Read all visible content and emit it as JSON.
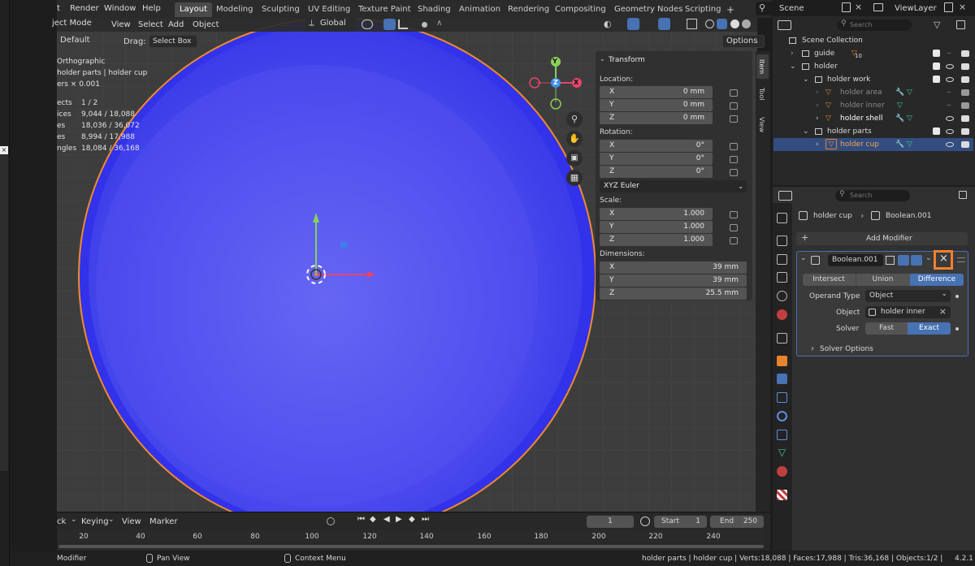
{
  "topbar": {
    "menus": [
      "t",
      "Render",
      "Window",
      "Help"
    ],
    "workspaces": [
      "Layout",
      "Modeling",
      "Sculpting",
      "UV Editing",
      "Texture Paint",
      "Shading",
      "Animation",
      "Rendering",
      "Compositing",
      "Geometry Nodes",
      "Scripting"
    ],
    "add_tab": "+",
    "scene": "Scene",
    "view_layer": "ViewLayer"
  },
  "viewport_header": {
    "mode": "ject Mode",
    "menus": [
      "View",
      "Select",
      "Add",
      "Object"
    ],
    "transform_orientation": "Global",
    "options": "Options"
  },
  "tool_settings": {
    "orientation": "Default",
    "drag_label": "Drag:",
    "drag_value": "Select Box"
  },
  "overlay_info": {
    "view": "Orthographic",
    "collection": "holder parts | holder cup",
    "units": "ers × 0.001",
    "stats": [
      {
        "label": "ects",
        "value": "1 / 2"
      },
      {
        "label": "ices",
        "value": "9,044 / 18,088"
      },
      {
        "label": "es",
        "value": "18,036 / 36,072"
      },
      {
        "label": "es",
        "value": "8,994 / 17,988"
      },
      {
        "label": "ngles",
        "value": "18,084 / 36,168"
      }
    ]
  },
  "gizmo": {
    "x": "X",
    "y": "Y",
    "z": "Z"
  },
  "n_panel": {
    "tabs": [
      "Item",
      "Tool",
      "View"
    ],
    "title": "Transform",
    "location_label": "Location:",
    "location": [
      {
        "axis": "X",
        "value": "0 mm"
      },
      {
        "axis": "Y",
        "value": "0 mm"
      },
      {
        "axis": "Z",
        "value": "0 mm"
      }
    ],
    "rotation_label": "Rotation:",
    "rotation": [
      {
        "axis": "X",
        "value": "0°"
      },
      {
        "axis": "Y",
        "value": "0°"
      },
      {
        "axis": "Z",
        "value": "0°"
      }
    ],
    "rotation_mode": "XYZ Euler",
    "scale_label": "Scale:",
    "scale": [
      {
        "axis": "X",
        "value": "1.000"
      },
      {
        "axis": "Y",
        "value": "1.000"
      },
      {
        "axis": "Z",
        "value": "1.000"
      }
    ],
    "dimensions_label": "Dimensions:",
    "dimensions": [
      {
        "axis": "X",
        "value": "39 mm"
      },
      {
        "axis": "Y",
        "value": "39 mm"
      },
      {
        "axis": "Z",
        "value": "25.5 mm"
      }
    ]
  },
  "outliner": {
    "search_placeholder": "Search",
    "items": [
      {
        "label": "Scene Collection"
      },
      {
        "label": "guide",
        "badge": "10"
      },
      {
        "label": "holder"
      },
      {
        "label": "holder work"
      },
      {
        "label": "holder area"
      },
      {
        "label": "holder inner"
      },
      {
        "label": "holder shell"
      },
      {
        "label": "holder parts"
      },
      {
        "label": "holder cup"
      }
    ]
  },
  "properties": {
    "search_placeholder": "Search",
    "breadcrumb_object": "holder cup",
    "breadcrumb_modifier": "Boolean.001",
    "add_modifier": "Add Modifier",
    "modifier_name": "Boolean.001",
    "operations": [
      "Intersect",
      "Union",
      "Difference"
    ],
    "active_operation": "Difference",
    "operand_type_label": "Operand Type",
    "operand_type": "Object",
    "object_label": "Object",
    "object_value": "holder inner",
    "solver_label": "Solver",
    "solvers": [
      "Fast",
      "Exact"
    ],
    "active_solver": "Exact",
    "solver_options": "Solver Options"
  },
  "timeline": {
    "menus": [
      "ck",
      "Keying",
      "View",
      "Marker"
    ],
    "current_frame": "1",
    "start_label": "Start",
    "start": "1",
    "end_label": "End",
    "end": "250",
    "ruler": [
      "20",
      "40",
      "60",
      "80",
      "100",
      "120",
      "140",
      "160",
      "180",
      "200",
      "220",
      "240"
    ]
  },
  "statusbar": {
    "left": "Modifier",
    "pan": "Pan View",
    "context": "Context Menu",
    "info": "holder parts | holder cup | Verts:18,088 | Faces:17,988 | Tris:36,168 | Objects:1/2 |",
    "version": "4.2.1"
  },
  "colors": {
    "accent": "#4772b3",
    "selected_row": "#334d80",
    "highlight_box": "#f0812e",
    "mesh_blue": "#3434e8",
    "object_origin_orange": "#e8842c"
  }
}
